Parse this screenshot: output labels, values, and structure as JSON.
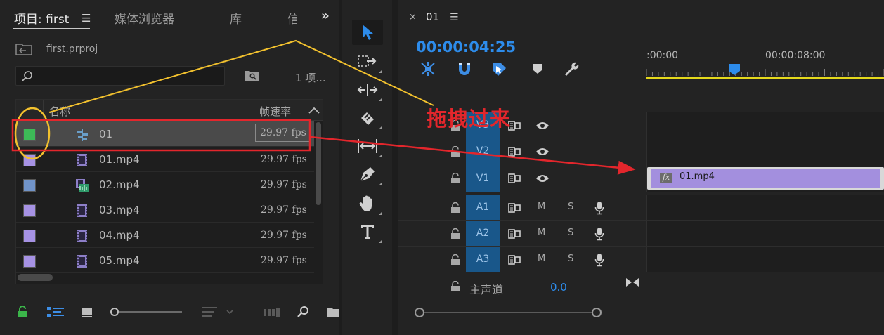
{
  "project_panel": {
    "tabs": [
      {
        "label": "项目: first",
        "active": true
      },
      {
        "label": "媒体浏览器"
      },
      {
        "label": "库"
      },
      {
        "label": "信息"
      }
    ],
    "project_file": "first.prproj",
    "search": {
      "value": "",
      "placeholder": ""
    },
    "item_count": "1 项...",
    "columns": {
      "name": "名称",
      "fps": "帧速率"
    },
    "rows": [
      {
        "name": "01",
        "fps": "29.97 fps",
        "type": "sequence",
        "swatch": "#3dba57",
        "selected": true
      },
      {
        "name": "01.mp4",
        "fps": "29.97 fps",
        "type": "video",
        "swatch": "#a692e4"
      },
      {
        "name": "02.mp4",
        "fps": "29.97 fps",
        "type": "video-audio",
        "swatch": "#7093c8"
      },
      {
        "name": "03.mp4",
        "fps": "29.97 fps",
        "type": "video",
        "swatch": "#a692e4"
      },
      {
        "name": "04.mp4",
        "fps": "29.97 fps",
        "type": "video",
        "swatch": "#a692e4"
      },
      {
        "name": "05.mp4",
        "fps": "29.97 fps",
        "type": "video",
        "swatch": "#a692e4"
      }
    ],
    "bottom_icons": [
      "lock-icon",
      "list-view-icon",
      "icon-view-icon",
      "zoom-slider",
      "sort-icon",
      "automate-icon",
      "find-icon",
      "new-bin-icon"
    ]
  },
  "tools": [
    "selection-tool",
    "track-select-tool",
    "ripple-edit-tool",
    "razor-tool",
    "slip-tool",
    "pen-tool",
    "hand-tool",
    "type-tool"
  ],
  "timeline": {
    "sequence_name": "01",
    "timecode": "00:00:04:25",
    "ruler_labels": [
      ":00:00",
      "00:00:08:00"
    ],
    "tracks": [
      {
        "id": "V3",
        "kind": "video"
      },
      {
        "id": "V2",
        "kind": "video"
      },
      {
        "id": "V1",
        "kind": "video"
      },
      {
        "id": "A1",
        "kind": "audio"
      },
      {
        "id": "A2",
        "kind": "audio"
      },
      {
        "id": "A3",
        "kind": "audio"
      }
    ],
    "mute_label": "M",
    "solo_label": "S",
    "master": {
      "label": "主声道",
      "value": "0.0"
    },
    "clip": {
      "name": "01.mp4",
      "fx_label": "fx",
      "track": "V1"
    }
  },
  "annotation": {
    "text": "拖拽过来",
    "color": "#e3262c",
    "highlight_color": "#f2c12e"
  },
  "colors": {
    "accent": "#2d8ceb",
    "track_target": "#19578a",
    "clip": "#a38fde",
    "work_area": "#e4d81c"
  }
}
